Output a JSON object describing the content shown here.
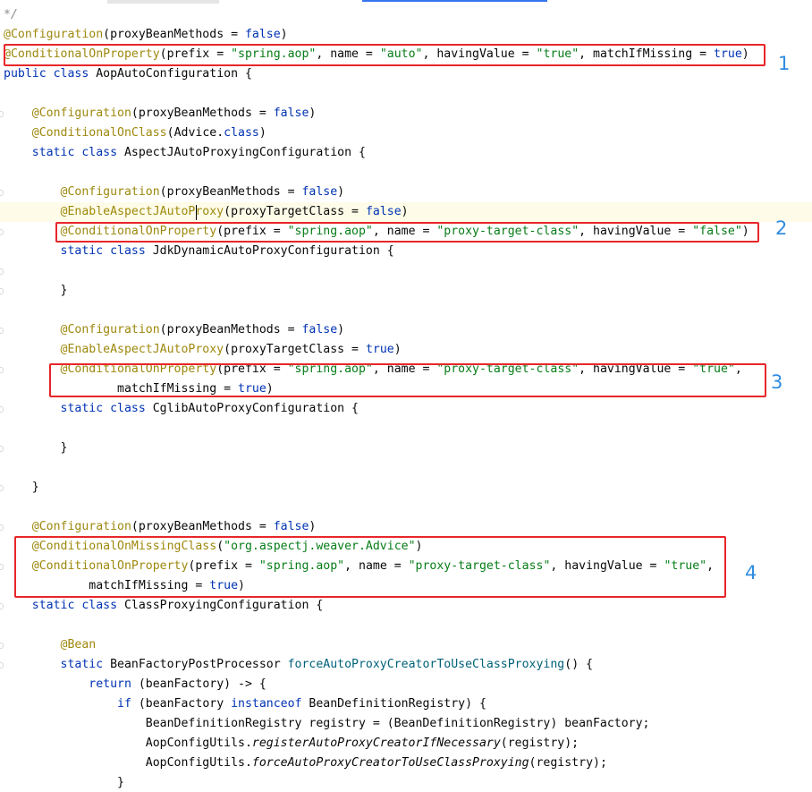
{
  "editor": {
    "language": "java",
    "caret_line": 10,
    "caret_col": 11,
    "lines": [
      [
        [
          "*/",
          "cmt"
        ]
      ],
      [
        [
          "@Configuration",
          "ann"
        ],
        [
          "(proxyBeanMethods = ",
          "pl"
        ],
        [
          "false",
          "kw"
        ],
        [
          ")",
          "pl"
        ]
      ],
      [
        [
          "@ConditionalOnProperty",
          "ann"
        ],
        [
          "(prefix = ",
          "pl"
        ],
        [
          "\"spring.aop\"",
          "str"
        ],
        [
          ", name = ",
          "pl"
        ],
        [
          "\"auto\"",
          "str"
        ],
        [
          ", havingValue = ",
          "pl"
        ],
        [
          "\"true\"",
          "str"
        ],
        [
          ", matchIfMissing = ",
          "pl"
        ],
        [
          "true",
          "kw"
        ],
        [
          ")",
          "pl"
        ]
      ],
      [
        [
          "public class ",
          "kw"
        ],
        [
          "AopAutoConfiguration {",
          "pl"
        ]
      ],
      [],
      [
        [
          "    @Configuration",
          "ann"
        ],
        [
          "(proxyBeanMethods = ",
          "pl"
        ],
        [
          "false",
          "kw"
        ],
        [
          ")",
          "pl"
        ]
      ],
      [
        [
          "    @ConditionalOnClass",
          "ann"
        ],
        [
          "(Advice.",
          "pl"
        ],
        [
          "class",
          "kw"
        ],
        [
          ")",
          "pl"
        ]
      ],
      [
        [
          "    static class ",
          "kw"
        ],
        [
          "AspectJAutoProxyingConfiguration {",
          "pl"
        ]
      ],
      [],
      [
        [
          "        @Configuration",
          "ann"
        ],
        [
          "(proxyBeanMethods = ",
          "pl"
        ],
        [
          "false",
          "kw"
        ],
        [
          ")",
          "pl"
        ]
      ],
      [
        [
          "        @EnableAspectJAutoProxy",
          "ann"
        ],
        [
          "(proxyTargetClass = ",
          "pl"
        ],
        [
          "false",
          "kw"
        ],
        [
          ")",
          "pl"
        ]
      ],
      [
        [
          "        @ConditionalOnProperty",
          "ann"
        ],
        [
          "(prefix = ",
          "pl"
        ],
        [
          "\"spring.aop\"",
          "str"
        ],
        [
          ", name = ",
          "pl"
        ],
        [
          "\"proxy-target-class\"",
          "str"
        ],
        [
          ", havingValue = ",
          "pl"
        ],
        [
          "\"false\"",
          "str"
        ],
        [
          ")",
          "pl"
        ]
      ],
      [
        [
          "        static class ",
          "kw"
        ],
        [
          "JdkDynamicAutoProxyConfiguration {",
          "pl"
        ]
      ],
      [],
      [
        [
          "        }",
          "pl"
        ]
      ],
      [],
      [
        [
          "        @Configuration",
          "ann"
        ],
        [
          "(proxyBeanMethods = ",
          "pl"
        ],
        [
          "false",
          "kw"
        ],
        [
          ")",
          "pl"
        ]
      ],
      [
        [
          "        @EnableAspectJAutoProxy",
          "ann"
        ],
        [
          "(proxyTargetClass = ",
          "pl"
        ],
        [
          "true",
          "kw"
        ],
        [
          ")",
          "pl"
        ]
      ],
      [
        [
          "        @ConditionalOnProperty",
          "ann"
        ],
        [
          "(prefix = ",
          "pl"
        ],
        [
          "\"spring.aop\"",
          "str"
        ],
        [
          ", name = ",
          "pl"
        ],
        [
          "\"proxy-target-class\"",
          "str"
        ],
        [
          ", havingValue = ",
          "pl"
        ],
        [
          "\"true\"",
          "str"
        ],
        [
          ",",
          "pl"
        ]
      ],
      [
        [
          "                matchIfMissing = ",
          "pl"
        ],
        [
          "true",
          "kw"
        ],
        [
          ")",
          "pl"
        ]
      ],
      [
        [
          "        static class ",
          "kw"
        ],
        [
          "CglibAutoProxyConfiguration {",
          "pl"
        ]
      ],
      [],
      [
        [
          "        }",
          "pl"
        ]
      ],
      [],
      [
        [
          "    }",
          "pl"
        ]
      ],
      [],
      [
        [
          "    @Configuration",
          "ann"
        ],
        [
          "(proxyBeanMethods = ",
          "pl"
        ],
        [
          "false",
          "kw"
        ],
        [
          ")",
          "pl"
        ]
      ],
      [
        [
          "    @ConditionalOnMissingClass",
          "ann"
        ],
        [
          "(",
          "pl"
        ],
        [
          "\"org.aspectj.weaver.Advice\"",
          "str"
        ],
        [
          ")",
          "pl"
        ]
      ],
      [
        [
          "    @ConditionalOnProperty",
          "ann"
        ],
        [
          "(prefix = ",
          "pl"
        ],
        [
          "\"spring.aop\"",
          "str"
        ],
        [
          ", name = ",
          "pl"
        ],
        [
          "\"proxy-target-class\"",
          "str"
        ],
        [
          ", havingValue = ",
          "pl"
        ],
        [
          "\"true\"",
          "str"
        ],
        [
          ",",
          "pl"
        ]
      ],
      [
        [
          "            matchIfMissing = ",
          "pl"
        ],
        [
          "true",
          "kw"
        ],
        [
          ")",
          "pl"
        ]
      ],
      [
        [
          "    static class ",
          "kw"
        ],
        [
          "ClassProxyingConfiguration {",
          "pl"
        ]
      ],
      [],
      [
        [
          "        @Bean",
          "ann"
        ]
      ],
      [
        [
          "        static ",
          "kw"
        ],
        [
          "BeanFactoryPostProcessor ",
          "pl"
        ],
        [
          "forceAutoProxyCreatorToUseClassProxying",
          "fn"
        ],
        [
          "() {",
          "pl"
        ]
      ],
      [
        [
          "            return ",
          "kw"
        ],
        [
          "(beanFactory) -> {",
          "pl"
        ]
      ],
      [
        [
          "                if ",
          "kw"
        ],
        [
          "(beanFactory ",
          "pl"
        ],
        [
          "instanceof ",
          "kw"
        ],
        [
          "BeanDefinitionRegistry) {",
          "pl"
        ]
      ],
      [
        [
          "                    BeanDefinitionRegistry registry = (BeanDefinitionRegistry) beanFactory;",
          "pl"
        ]
      ],
      [
        [
          "                    AopConfigUtils.",
          "pl"
        ],
        [
          "registerAutoProxyCreatorIfNecessary",
          "it"
        ],
        [
          "(registry);",
          "pl"
        ]
      ],
      [
        [
          "                    AopConfigUtils.",
          "pl"
        ],
        [
          "forceAutoProxyCreatorToUseClassProxying",
          "it"
        ],
        [
          "(registry);",
          "pl"
        ]
      ],
      [
        [
          "                }",
          "pl"
        ]
      ]
    ]
  },
  "callouts": [
    {
      "label": "1"
    },
    {
      "label": "2"
    },
    {
      "label": "3"
    },
    {
      "label": "4"
    }
  ],
  "colors": {
    "annotation": "#9e880d",
    "keyword": "#0033b3",
    "string": "#067d17",
    "comment": "#8c8c8c",
    "method": "#00627a",
    "callout_border": "#e8262a",
    "callout_number": "#2f8ce0",
    "caret_row": "#fefce8"
  }
}
